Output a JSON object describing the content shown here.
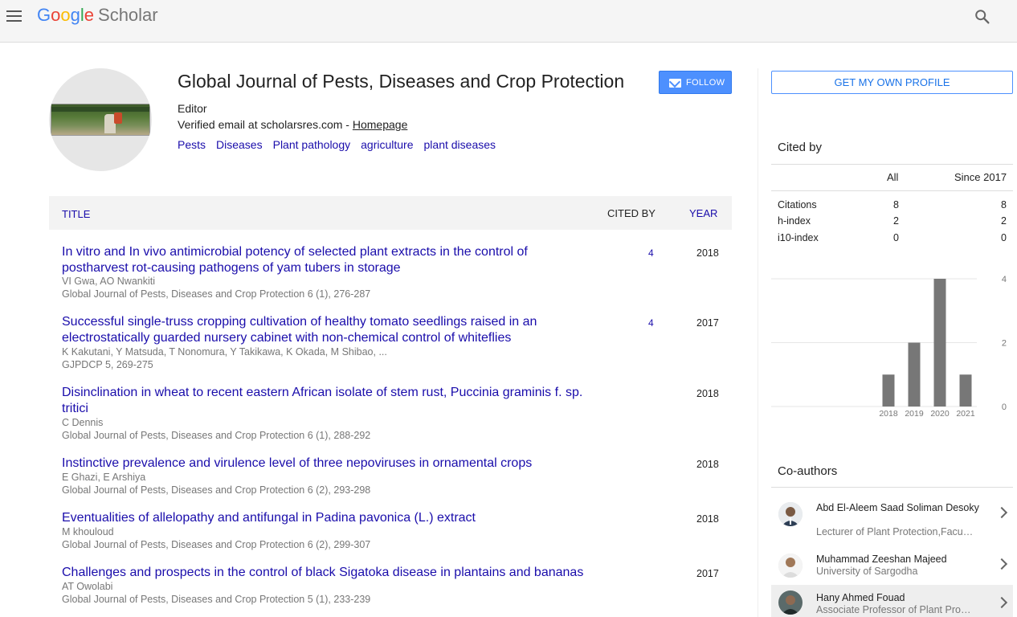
{
  "header": {
    "logo_letters": [
      "G",
      "o",
      "o",
      "g",
      "l",
      "e"
    ],
    "logo_product": "Scholar"
  },
  "profile": {
    "name": "Global Journal of Pests, Diseases and Crop Protection",
    "affiliation": "Editor",
    "email_text": "Verified email at scholarsres.com - ",
    "homepage_label": "Homepage",
    "follow_label": "FOLLOW",
    "interests": [
      "Pests",
      "Diseases",
      "Plant pathology",
      "agriculture",
      "plant diseases"
    ]
  },
  "table": {
    "col_title": "TITLE",
    "col_cited": "CITED BY",
    "col_year": "YEAR",
    "rows": [
      {
        "title": "In vitro and In vivo antimicrobial potency of selected plant extracts in the control of postharvest rot-causing pathogens of yam tubers in storage",
        "authors": "VI Gwa, AO Nwankiti",
        "venue": "Global Journal of Pests, Diseases and Crop Protection 6 (1), 276-287",
        "cited": "4",
        "year": "2018"
      },
      {
        "title": "Successful single-truss cropping cultivation of healthy tomato seedlings raised in an electrostatically guarded nursery cabinet with non-chemical control of whiteflies",
        "authors": "K Kakutani, Y Matsuda, T Nonomura, Y Takikawa, K Okada, M Shibao, ...",
        "venue": "GJPDCP 5, 269-275",
        "cited": "4",
        "year": "2017"
      },
      {
        "title": "Disinclination in wheat to recent eastern African isolate of stem rust, Puccinia graminis f. sp. tritici",
        "authors": "C Dennis",
        "venue": "Global Journal of Pests, Diseases and Crop Protection 6 (1), 288-292",
        "cited": "",
        "year": "2018"
      },
      {
        "title": "Instinctive prevalence and virulence level of three nepoviruses in ornamental crops",
        "authors": "E Ghazi, E Arshiya",
        "venue": "Global Journal of Pests, Diseases and Crop Protection 6 (2), 293-298",
        "cited": "",
        "year": "2018"
      },
      {
        "title": "Eventualities of allelopathy and antifungal in Padina pavonica (L.) extract",
        "authors": "M khouloud",
        "venue": "Global Journal of Pests, Diseases and Crop Protection 6 (2), 299-307",
        "cited": "",
        "year": "2018"
      },
      {
        "title": "Challenges and prospects in the control of black Sigatoka disease in plantains and bananas",
        "authors": "AT Owolabi",
        "venue": "Global Journal of Pests, Diseases and Crop Protection 5 (1), 233-239",
        "cited": "",
        "year": "2017"
      }
    ]
  },
  "sidebar": {
    "own_profile_label": "GET MY OWN PROFILE",
    "cited_by_title": "Cited by",
    "col_all": "All",
    "col_since": "Since 2017",
    "metrics": [
      {
        "label": "Citations",
        "all": "8",
        "since": "8"
      },
      {
        "label": "h-index",
        "all": "2",
        "since": "2"
      },
      {
        "label": "i10-index",
        "all": "0",
        "since": "0"
      }
    ],
    "coauthors_title": "Co-authors",
    "coauthors": [
      {
        "name": "Abd El-Aleem Saad Soliman Desoky",
        "affiliation": "Lecturer of Plant Protection,Facu…"
      },
      {
        "name": "Muhammad Zeeshan Majeed",
        "affiliation": "University of Sargodha"
      },
      {
        "name": "Hany Ahmed Fouad",
        "affiliation": "Associate Professor of Plant Pro…"
      }
    ]
  },
  "chart_data": {
    "type": "bar",
    "categories": [
      "2018",
      "2019",
      "2020",
      "2021"
    ],
    "values": [
      1,
      2,
      4,
      1
    ],
    "yticks": [
      0,
      2,
      4
    ],
    "ylim": [
      0,
      4
    ],
    "bar_color": "#777777",
    "grid": true
  }
}
